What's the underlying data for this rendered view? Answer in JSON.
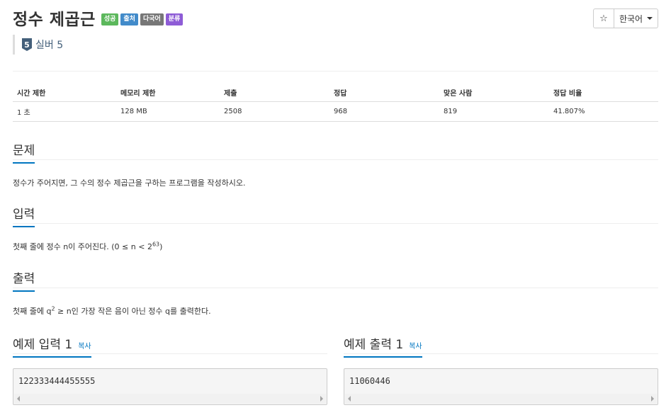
{
  "problem": {
    "title": "정수 제곱근",
    "badges": [
      {
        "label": "성공",
        "color": "#5cb85c"
      },
      {
        "label": "출처",
        "color": "#428bca"
      },
      {
        "label": "다국어",
        "color": "#777777"
      },
      {
        "label": "분류",
        "color": "#8e5cd6"
      }
    ],
    "tier_number": "5",
    "tier_label": "실버 5"
  },
  "toolbar": {
    "star_symbol": "☆",
    "language_label": "한국어"
  },
  "stats": {
    "headers": [
      "시간 제한",
      "메모리 제한",
      "제출",
      "정답",
      "맞은 사람",
      "정답 비율"
    ],
    "values": [
      "1 초",
      "128 MB",
      "2508",
      "968",
      "819",
      "41.807%"
    ]
  },
  "sections": {
    "description": {
      "heading": "문제",
      "text": "정수가 주어지면, 그 수의 정수 제곱근을 구하는 프로그램을 작성하시오."
    },
    "input": {
      "heading": "입력",
      "text_before": "첫째 줄에 정수 n이 주어진다. (0 ≤ n < 2",
      "exponent": "63",
      "text_after": ")"
    },
    "output": {
      "heading": "출력",
      "text_before": "첫째 줄에 q",
      "exponent": "2",
      "text_after": " ≥ n인 가장 작은 음이 아닌 정수 q를 출력한다."
    }
  },
  "samples": {
    "input": {
      "label": "예제 입력 1",
      "copy_label": "복사",
      "content": "122333444455555"
    },
    "output": {
      "label": "예제 출력 1",
      "copy_label": "복사",
      "content": "11060446"
    }
  }
}
